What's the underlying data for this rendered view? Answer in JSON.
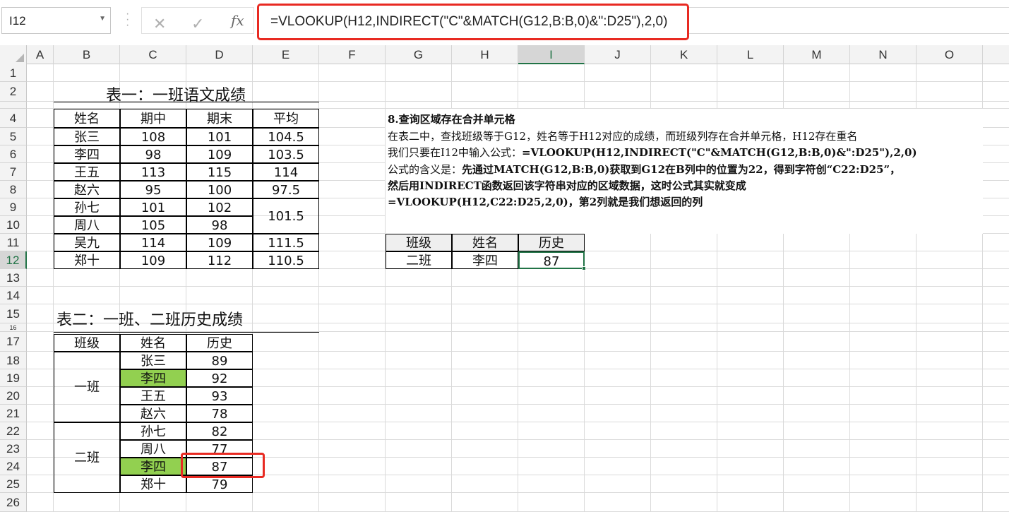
{
  "namebox": "I12",
  "formula": "=VLOOKUP(H12,INDIRECT(\"C\"&MATCH(G12,B:B,0)&\":D25\"),2,0)",
  "columns": [
    "A",
    "B",
    "C",
    "D",
    "E",
    "F",
    "G",
    "H",
    "I",
    "J",
    "K",
    "L",
    "M",
    "N",
    "O"
  ],
  "selected_column": "I",
  "rows": [
    "1",
    "2",
    "",
    "4",
    "5",
    "6",
    "7",
    "8",
    "9",
    "10",
    "11",
    "12",
    "13",
    "14",
    "15",
    "16",
    "17",
    "18",
    "19",
    "20",
    "21",
    "22",
    "23",
    "24",
    "25",
    "26"
  ],
  "selected_row": "12",
  "table1": {
    "title": "表一：一班语文成绩",
    "headers": [
      "姓名",
      "期中",
      "期末",
      "平均"
    ],
    "rows": [
      [
        "张三",
        "108",
        "101",
        "104.5"
      ],
      [
        "李四",
        "98",
        "109",
        "103.5"
      ],
      [
        "王五",
        "113",
        "115",
        "114"
      ],
      [
        "赵六",
        "95",
        "100",
        "97.5"
      ],
      [
        "孙七",
        "101",
        "102",
        "101.5"
      ],
      [
        "周八",
        "105",
        "98",
        ""
      ],
      [
        "吴九",
        "114",
        "109",
        "111.5"
      ],
      [
        "郑十",
        "109",
        "112",
        "110.5"
      ]
    ]
  },
  "table2": {
    "title": "表二：一班、二班历史成绩",
    "headers": [
      "班级",
      "姓名",
      "历史"
    ],
    "class1": "一班",
    "class2": "二班",
    "rows": [
      [
        "张三",
        "89"
      ],
      [
        "李四",
        "92"
      ],
      [
        "王五",
        "93"
      ],
      [
        "赵六",
        "78"
      ],
      [
        "孙七",
        "82"
      ],
      [
        "周八",
        "77"
      ],
      [
        "李四",
        "87"
      ],
      [
        "郑十",
        "79"
      ]
    ]
  },
  "notes": {
    "heading": "8.查询区域存在合并单元格",
    "line1": "在表二中，查找班级等于G12，姓名等于H12对应的成绩，而班级列存在合并单元格，H12存在重名",
    "line2a": "我们只要在I12中输入公式：",
    "line2b": "=VLOOKUP(H12,INDIRECT(\"C\"&MATCH(G12,B:B,0)&\":D25\"),2,0)",
    "line3a": "公式的含义是：",
    "line3b": "先通过MATCH(G12,B:B,0)获取到G12在B列中的位置为22，得到字符创“C22:D25”，",
    "line4": "然后用INDIRECT函数返回该字符串对应的区域数据，这时公式其实就变成",
    "line5": "=VLOOKUP(H12,C22:D25,2,0)，第2列就是我们想返回的列"
  },
  "lookup": {
    "headers": [
      "班级",
      "姓名",
      "历史"
    ],
    "values": [
      "二班",
      "李四",
      "87"
    ]
  },
  "colors": {
    "highlight_green": "#92d050",
    "red_box": "#e82a22",
    "excel_green": "#217346"
  }
}
